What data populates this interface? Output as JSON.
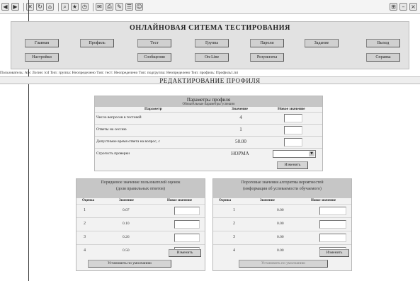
{
  "browser": {
    "toolbar_icons": [
      "back-icon",
      "forward-icon",
      "stop-icon",
      "refresh-icon",
      "home-icon",
      "search-icon",
      "favorites-icon",
      "history-icon",
      "mail-icon",
      "print-icon",
      "edit-icon",
      "discuss-icon",
      "messenger-icon"
    ],
    "logo_glyph": "⊞"
  },
  "site": {
    "title": "ОНЛАЙНОВАЯ СИТЕМА ТЕСТИРОВАНИЯ"
  },
  "nav": {
    "row1": [
      "Главная",
      "Профиль",
      "Тест",
      "Группа",
      "Пароли",
      "Задание",
      "Выход"
    ],
    "row2": [
      "Настройки",
      "Сообщения",
      "On-Line",
      "Результаты",
      "Справка"
    ]
  },
  "status_line": "Пользователь: Abc  Логин: lcd  Тип: группа: Неопределено  Тип: тест: Неопределено  Тип: подгруппа: Неопределено  Тип: профиль: Профиль1.ini",
  "page_title": "РЕДАКТИРОВАНИЕ ПРОФИЛЯ",
  "params": {
    "title": "Параметры профиля",
    "subtitle": "Обязательные параметры успешно",
    "col_param": "Параметр",
    "col_value": "Значение",
    "col_new": "Новое значение",
    "rows": [
      {
        "label": "Число вопросов в тестовой",
        "value": "4"
      },
      {
        "label": "Ответы на сессию",
        "value": "1"
      },
      {
        "label": "Допустимое время ответа на вопрос, с",
        "value": "50.00"
      },
      {
        "label": "Строгость проверки",
        "value": "НОРМА"
      }
    ],
    "change_button": "Изменить"
  },
  "left_panel": {
    "title_line1": "Порядковое значение пользователей оценок",
    "title_line2": "(доля правильных ответов)",
    "col1": "Оценка",
    "col2": "Значение",
    "col3": "Новое значение",
    "rows": [
      {
        "grade": "1",
        "value": "0.07"
      },
      {
        "grade": "2",
        "value": "0.10"
      },
      {
        "grade": "3",
        "value": "0.26"
      },
      {
        "grade": "4",
        "value": "0.50"
      }
    ],
    "change_button": "Изменить",
    "default_button": "Установить по умолчанию"
  },
  "right_panel": {
    "title_line1": "Пороговые значения алгоритма вероятностей",
    "title_line2": "(информация об успеваемости обучаемого)",
    "col1": "Оценка",
    "col2": "Значение",
    "col3": "Новое значение",
    "rows": [
      {
        "grade": "1",
        "value": "0.00"
      },
      {
        "grade": "2",
        "value": "0.00"
      },
      {
        "grade": "3",
        "value": "0.00"
      },
      {
        "grade": "4",
        "value": "0.00"
      }
    ],
    "change_button": "Изменить",
    "default_button": "Установить по умолчанию"
  }
}
